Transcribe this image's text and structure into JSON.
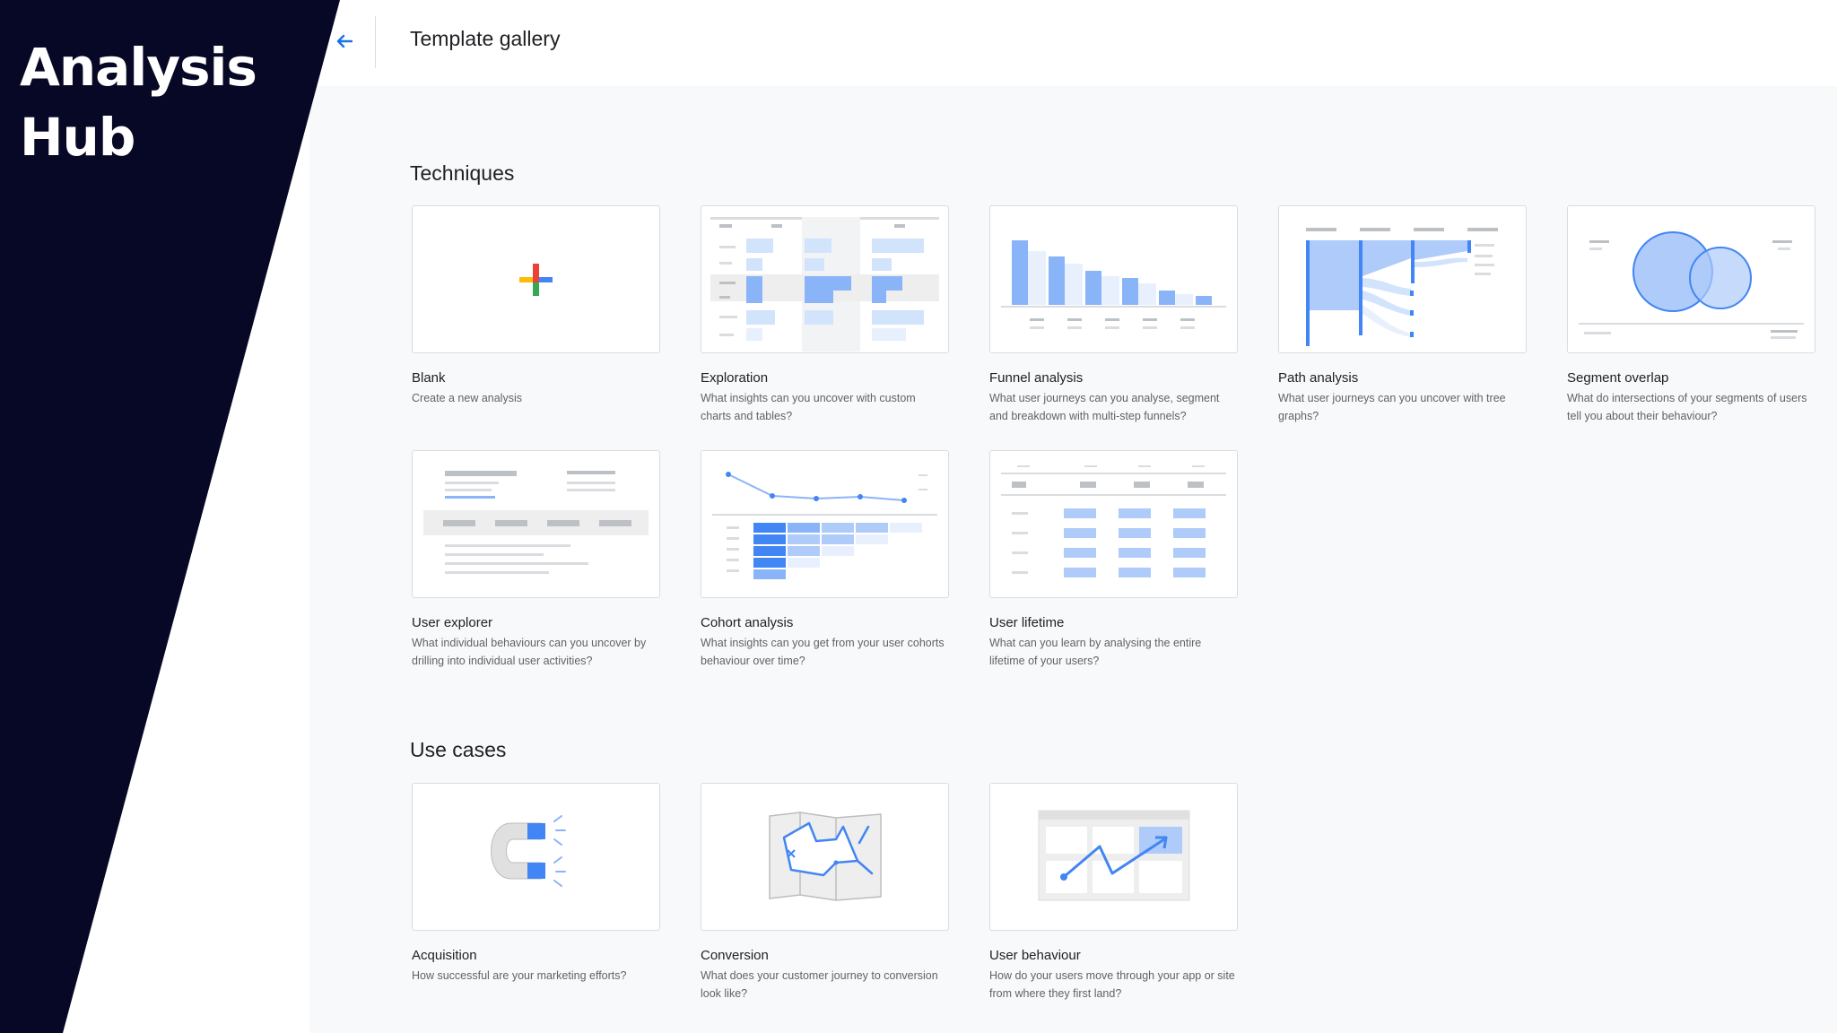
{
  "brand": {
    "line1": "Analysis",
    "line2": "Hub"
  },
  "header": {
    "title": "Template gallery",
    "back_icon": "arrow-left-icon"
  },
  "colors": {
    "navy": "#070825",
    "accent_blue": "#1a73e8",
    "light_blue": "#aecbfa",
    "mid_blue": "#8ab4f8"
  },
  "techniques": {
    "title": "Techniques",
    "cards": [
      {
        "title": "Blank",
        "description": "Create a new analysis"
      },
      {
        "title": "Exploration",
        "description": "What insights can you uncover with custom charts and tables?"
      },
      {
        "title": "Funnel analysis",
        "description": "What user journeys can you analyse, segment and breakdown with multi-step funnels?"
      },
      {
        "title": "Path analysis",
        "description": "What user journeys can you uncover with tree graphs?"
      },
      {
        "title": "Segment overlap",
        "description": "What do intersections of your segments of users tell you about their behaviour?"
      },
      {
        "title": "User explorer",
        "description": "What individual behaviours can you uncover by drilling into individual user activities?"
      },
      {
        "title": "Cohort analysis",
        "description": "What insights can you get from your user cohorts behaviour over time?"
      },
      {
        "title": "User lifetime",
        "description": "What can you learn by analysing the entire lifetime of your users?"
      }
    ]
  },
  "use_cases": {
    "title": "Use cases",
    "cards": [
      {
        "title": "Acquisition",
        "description": "How successful are your marketing efforts?"
      },
      {
        "title": "Conversion",
        "description": "What does your customer journey to conversion look like?"
      },
      {
        "title": "User behaviour",
        "description": "How do your users move through your app or site from where they first land?"
      }
    ]
  }
}
